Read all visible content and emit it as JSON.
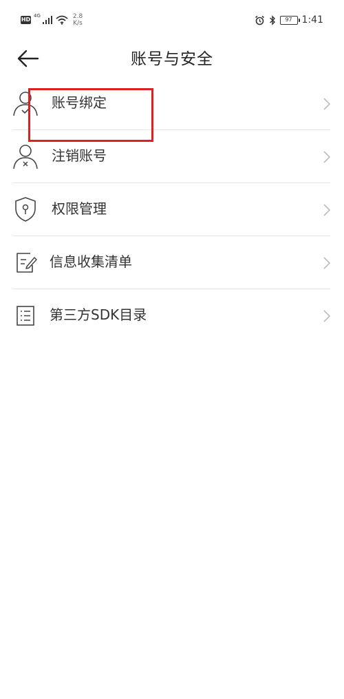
{
  "status_bar": {
    "hd_badge": "HD",
    "network_type": "4G",
    "speed_value": "2.8",
    "speed_unit": "K/s",
    "battery": "97",
    "time": "1:41"
  },
  "header": {
    "title": "账号与安全"
  },
  "menu": {
    "items": [
      {
        "label": "账号绑定",
        "icon": "user-check-icon"
      },
      {
        "label": "注销账号",
        "icon": "user-remove-icon"
      },
      {
        "label": "权限管理",
        "icon": "shield-keyhole-icon"
      },
      {
        "label": "信息收集清单",
        "icon": "document-edit-icon"
      },
      {
        "label": "第三方SDK目录",
        "icon": "list-icon"
      }
    ]
  },
  "colors": {
    "highlight": "#e02020",
    "text": "#333333",
    "divider": "#e4e4e4"
  }
}
